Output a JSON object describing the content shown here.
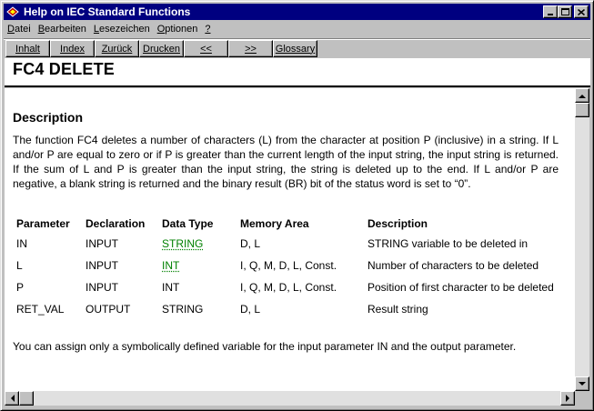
{
  "window": {
    "title": "Help on IEC Standard Functions"
  },
  "menu": [
    {
      "label": "Datei"
    },
    {
      "label": "Bearbeiten"
    },
    {
      "label": "Lesezeichen"
    },
    {
      "label": "Optionen"
    },
    {
      "label": "?"
    }
  ],
  "buttons": [
    {
      "label": "Inhalt"
    },
    {
      "label": "Index"
    },
    {
      "label": "Zurück"
    },
    {
      "label": "Drucken"
    },
    {
      "label": "<<"
    },
    {
      "label": ">>"
    },
    {
      "label": "Glossary"
    }
  ],
  "page": {
    "heading": "FC4  DELETE",
    "section_title": "Description",
    "description": "The function FC4 deletes a number of characters (L) from the character at position P (inclusive) in a string. If L and/or P are equal to zero or if P is greater than the current length of the input string, the input string is returned. If the sum of L and P is greater than the input string, the string is deleted up to the end. If L and/or P are negative, a blank string is returned and the binary result (BR) bit of the status word is set to “0”.",
    "table": {
      "headers": [
        "Parameter",
        "Declaration",
        "Data Type",
        "Memory Area",
        "Description"
      ],
      "rows": [
        [
          "IN",
          "INPUT",
          "STRING",
          "D, L",
          "STRING variable to be deleted in"
        ],
        [
          "L",
          "INPUT",
          "INT",
          "I, Q, M, D, L, Const.",
          "Number of characters to be deleted"
        ],
        [
          "P",
          "INPUT",
          "INT",
          "I, Q, M, D, L, Const.",
          "Position of first character to be deleted"
        ],
        [
          "RET_VAL",
          "OUTPUT",
          "STRING",
          "D, L",
          "Result string"
        ]
      ]
    },
    "footnote": "You can assign only a symbolically defined variable for the input parameter IN and the output parameter."
  },
  "icons": {
    "app": "help-book-icon",
    "minimize": "minimize-icon",
    "maximize": "maximize-icon",
    "close": "close-icon"
  }
}
